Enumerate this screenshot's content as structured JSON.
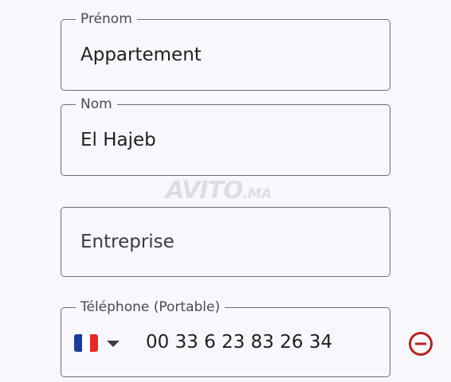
{
  "form": {
    "first_name": {
      "label": "Prénom",
      "value": "Appartement"
    },
    "last_name": {
      "label": "Nom",
      "value": "El Hajeb"
    },
    "company": {
      "placeholder": "Entreprise"
    },
    "phone": {
      "label": "Téléphone (Portable)",
      "value": "00 33 6 23 83 26 34",
      "country_flag": "france-flag-icon"
    }
  },
  "watermark": {
    "main": "AVITO",
    "suffix": ".MA"
  },
  "colors": {
    "background": "#f8f7fc",
    "border": "#6f6d74",
    "remove_icon": "#b3261e",
    "flag_blue": "#1a3a9c",
    "flag_white": "#ffffff",
    "flag_red": "#e52b2b"
  },
  "icons": {
    "remove": "remove-circle-icon",
    "caret": "caret-down-icon"
  }
}
